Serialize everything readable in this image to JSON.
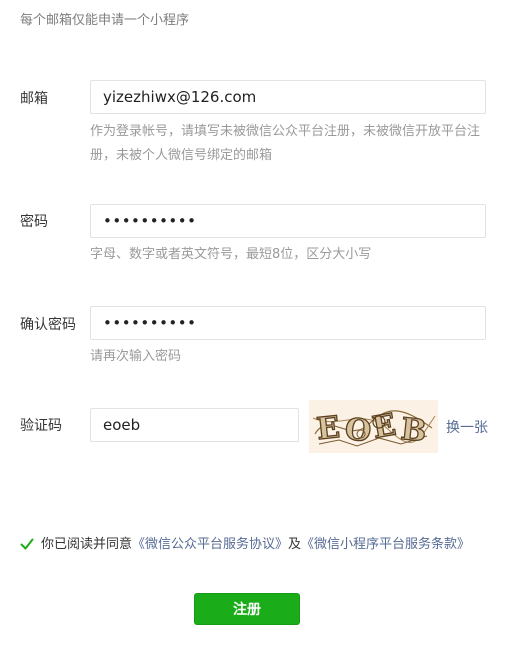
{
  "notice": "每个邮箱仅能申请一个小程序",
  "email": {
    "label": "邮箱",
    "value": "yizezhiwx@126.com",
    "hint": "作为登录帐号，请填写未被微信公众平台注册，未被微信开放平台注册，未被个人微信号绑定的邮箱"
  },
  "password": {
    "label": "密码",
    "masked": "••••••••••",
    "hint": "字母、数字或者英文符号，最短8位，区分大小写"
  },
  "confirm": {
    "label": "确认密码",
    "masked": "••••••••••",
    "hint": "请再次输入密码"
  },
  "captcha": {
    "label": "验证码",
    "value": "eoeb",
    "image_text": "EOEB",
    "refresh_label": "换一张"
  },
  "agreement": {
    "checked": true,
    "prefix": "你已阅读并同意",
    "link1": "《微信公众平台服务协议》",
    "middle": "及",
    "link2": "《微信小程序平台服务条款》"
  },
  "submit_label": "注册",
  "colors": {
    "primary": "#1aad19",
    "link": "#576b95",
    "hint": "#9a9a9a",
    "border": "#e3e3e3"
  }
}
